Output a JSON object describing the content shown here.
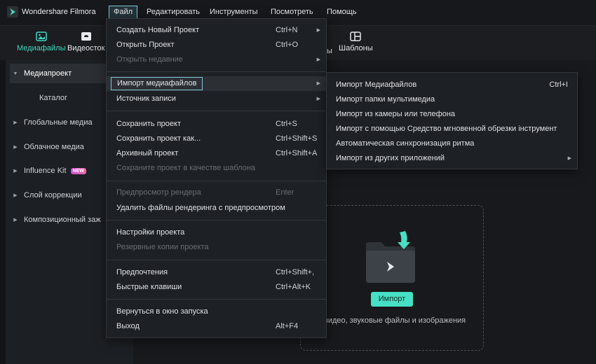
{
  "app": {
    "name": "Wondershare Filmora"
  },
  "menubar": [
    "Файл",
    "Редактировать",
    "Инструменты",
    "Посмотреть",
    "Помощь"
  ],
  "toolbar": {
    "tabs": [
      {
        "label": "Медиафайлы",
        "icon": "media-icon",
        "active": true
      },
      {
        "label": "Видеосток",
        "icon": "stock-video-icon"
      },
      {
        "label": "ы",
        "icon": ""
      },
      {
        "label": "Шаблоны",
        "icon": "templates-icon"
      }
    ]
  },
  "sidebar": {
    "items": [
      {
        "label": "Медиапроект",
        "expanded": true,
        "selected": true
      },
      {
        "label": "Каталог"
      },
      {
        "label": "Глобальные медиа"
      },
      {
        "label": "Облачное медиа"
      },
      {
        "label": "Influence Kit",
        "badge": "NEW"
      },
      {
        "label": "Слой коррекции"
      },
      {
        "label": "Композиционный заж"
      }
    ]
  },
  "file_menu": {
    "items": [
      {
        "label": "Создать Новый Проект",
        "shortcut": "Ctrl+N",
        "submenu": true
      },
      {
        "label": "Открыть Проект",
        "shortcut": "Ctrl+O"
      },
      {
        "label": "Открыть недавние",
        "disabled": true,
        "submenu": true
      },
      {
        "label": "Импорт медиафайлов",
        "highlighted": true,
        "submenu": true
      },
      {
        "label": "Источник записи",
        "submenu": true
      },
      {
        "label": "Сохранить проект",
        "shortcut": "Ctrl+S"
      },
      {
        "label": "Сохранить проект как...",
        "shortcut": "Ctrl+Shift+S"
      },
      {
        "label": "Архивный проект",
        "shortcut": "Ctrl+Shift+A"
      },
      {
        "label": "Сохраните проект в качестве шаблона",
        "disabled": true
      },
      {
        "label": "Предпросмотр рендера",
        "shortcut": "Enter",
        "disabled": true
      },
      {
        "label": "Удалить файлы рендеринга с предпросмотром"
      },
      {
        "label": "Настройки проекта"
      },
      {
        "label": "Резервные копии проекта",
        "disabled": true
      },
      {
        "label": "Предпочтения",
        "shortcut": "Ctrl+Shift+,"
      },
      {
        "label": "Быстрые клавиши",
        "shortcut": "Ctrl+Alt+K"
      },
      {
        "label": "Вернуться в окно запуска"
      },
      {
        "label": "Выход",
        "shortcut": "Alt+F4"
      }
    ]
  },
  "import_submenu": {
    "items": [
      {
        "label": "Импорт Медиафайлов",
        "shortcut": "Ctrl+I"
      },
      {
        "label": "Импорт папки мультимедиа"
      },
      {
        "label": "Импорт из камеры или телефона"
      },
      {
        "label": "Импорт с помощью Средство мгновенной обрезки інструмент"
      },
      {
        "label": "Автоматическая синхронизация ритма"
      },
      {
        "label": "Импорт из других приложений",
        "submenu": true
      }
    ]
  },
  "import_area": {
    "button": "Импорт",
    "hint": "видео, звуковые файлы и изображения"
  },
  "colors": {
    "accent": "#3fd6c1",
    "import_button": "#46e0c4",
    "focus_outline": "#7fc7d6"
  }
}
